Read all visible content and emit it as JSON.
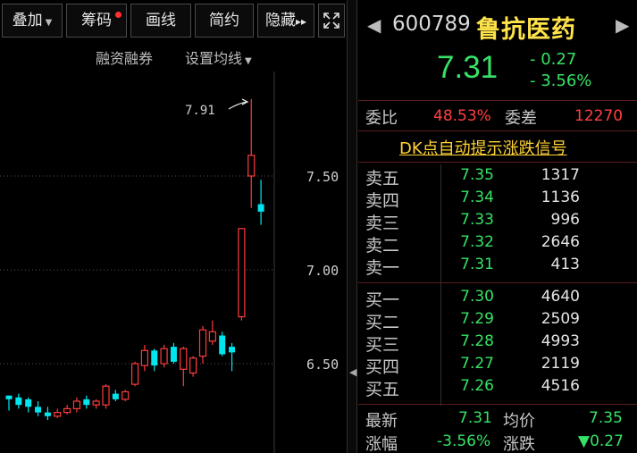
{
  "toolbar": {
    "overlay": "叠加",
    "chips": "筹码",
    "draw": "画线",
    "simple": "简约",
    "hide": "隐藏",
    "hide_arrows": "▸▸"
  },
  "subbar": {
    "margin": "融资融券",
    "ma_settings": "设置均线"
  },
  "chart": {
    "y_labels": [
      "7.50",
      "7.00",
      "6.50"
    ],
    "high_annotation": "7.91",
    "up_color": "#ff3b3b",
    "down_color": "#00e5ee"
  },
  "chart_data": {
    "type": "candlestick",
    "y_ticks": [
      7.5,
      7.0,
      6.5
    ],
    "annotation": {
      "label": "7.91",
      "value": 7.91
    },
    "candles": [
      {
        "o": 6.33,
        "c": 6.31,
        "h": 6.33,
        "l": 6.25
      },
      {
        "o": 6.32,
        "c": 6.28,
        "h": 6.34,
        "l": 6.26
      },
      {
        "o": 6.31,
        "c": 6.27,
        "h": 6.32,
        "l": 6.24
      },
      {
        "o": 6.27,
        "c": 6.24,
        "h": 6.3,
        "l": 6.22
      },
      {
        "o": 6.24,
        "c": 6.22,
        "h": 6.27,
        "l": 6.2
      },
      {
        "o": 6.22,
        "c": 6.24,
        "h": 6.26,
        "l": 6.21
      },
      {
        "o": 6.24,
        "c": 6.26,
        "h": 6.28,
        "l": 6.23
      },
      {
        "o": 6.26,
        "c": 6.3,
        "h": 6.32,
        "l": 6.24
      },
      {
        "o": 6.31,
        "c": 6.28,
        "h": 6.33,
        "l": 6.26
      },
      {
        "o": 6.28,
        "c": 6.3,
        "h": 6.31,
        "l": 6.26
      },
      {
        "o": 6.28,
        "c": 6.38,
        "h": 6.39,
        "l": 6.26
      },
      {
        "o": 6.34,
        "c": 6.31,
        "h": 6.36,
        "l": 6.3
      },
      {
        "o": 6.31,
        "c": 6.35,
        "h": 6.36,
        "l": 6.3
      },
      {
        "o": 6.39,
        "c": 6.5,
        "h": 6.51,
        "l": 6.38
      },
      {
        "o": 6.49,
        "c": 6.57,
        "h": 6.6,
        "l": 6.46
      },
      {
        "o": 6.57,
        "c": 6.49,
        "h": 6.58,
        "l": 6.46
      },
      {
        "o": 6.5,
        "c": 6.58,
        "h": 6.6,
        "l": 6.48
      },
      {
        "o": 6.59,
        "c": 6.51,
        "h": 6.61,
        "l": 6.5
      },
      {
        "o": 6.47,
        "c": 6.58,
        "h": 6.59,
        "l": 6.38
      },
      {
        "o": 6.45,
        "c": 6.53,
        "h": 6.54,
        "l": 6.43
      },
      {
        "o": 6.54,
        "c": 6.68,
        "h": 6.7,
        "l": 6.5
      },
      {
        "o": 6.62,
        "c": 6.67,
        "h": 6.73,
        "l": 6.6
      },
      {
        "o": 6.65,
        "c": 6.55,
        "h": 6.67,
        "l": 6.54
      },
      {
        "o": 6.59,
        "c": 6.56,
        "h": 6.61,
        "l": 6.46
      },
      {
        "o": 6.75,
        "c": 7.22,
        "h": 7.22,
        "l": 6.73
      },
      {
        "o": 7.5,
        "c": 7.61,
        "h": 7.91,
        "l": 7.33
      },
      {
        "o": 7.35,
        "c": 7.31,
        "h": 7.48,
        "l": 7.24
      }
    ]
  },
  "stock": {
    "code": "600789",
    "name": "鲁抗医药",
    "price": "7.31",
    "change": "- 0.27",
    "change_pct": "- 3.56%"
  },
  "stats": {
    "wei_bi_label": "委比",
    "wei_bi_value": "48.53%",
    "wei_cha_label": "委差",
    "wei_cha_value": "12270"
  },
  "dk_link": "DK点自动提示涨跌信号",
  "asks": [
    {
      "label": "卖五",
      "price": "7.35",
      "volume": "1317"
    },
    {
      "label": "卖四",
      "price": "7.34",
      "volume": "1136"
    },
    {
      "label": "卖三",
      "price": "7.33",
      "volume": "996"
    },
    {
      "label": "卖二",
      "price": "7.32",
      "volume": "2646"
    },
    {
      "label": "卖一",
      "price": "7.31",
      "volume": "413"
    }
  ],
  "bids": [
    {
      "label": "买一",
      "price": "7.30",
      "volume": "4640"
    },
    {
      "label": "买二",
      "price": "7.29",
      "volume": "2509"
    },
    {
      "label": "买三",
      "price": "7.28",
      "volume": "4993"
    },
    {
      "label": "买四",
      "price": "7.27",
      "volume": "2119"
    },
    {
      "label": "买五",
      "price": "7.26",
      "volume": "4516"
    }
  ],
  "bottom": {
    "latest_label": "最新",
    "latest_value": "7.31",
    "avg_label": "均价",
    "avg_value": "7.35",
    "range_label": "涨幅",
    "range_value": "-3.56%",
    "updown_label": "涨跌",
    "updown_value": "▼0.27"
  }
}
